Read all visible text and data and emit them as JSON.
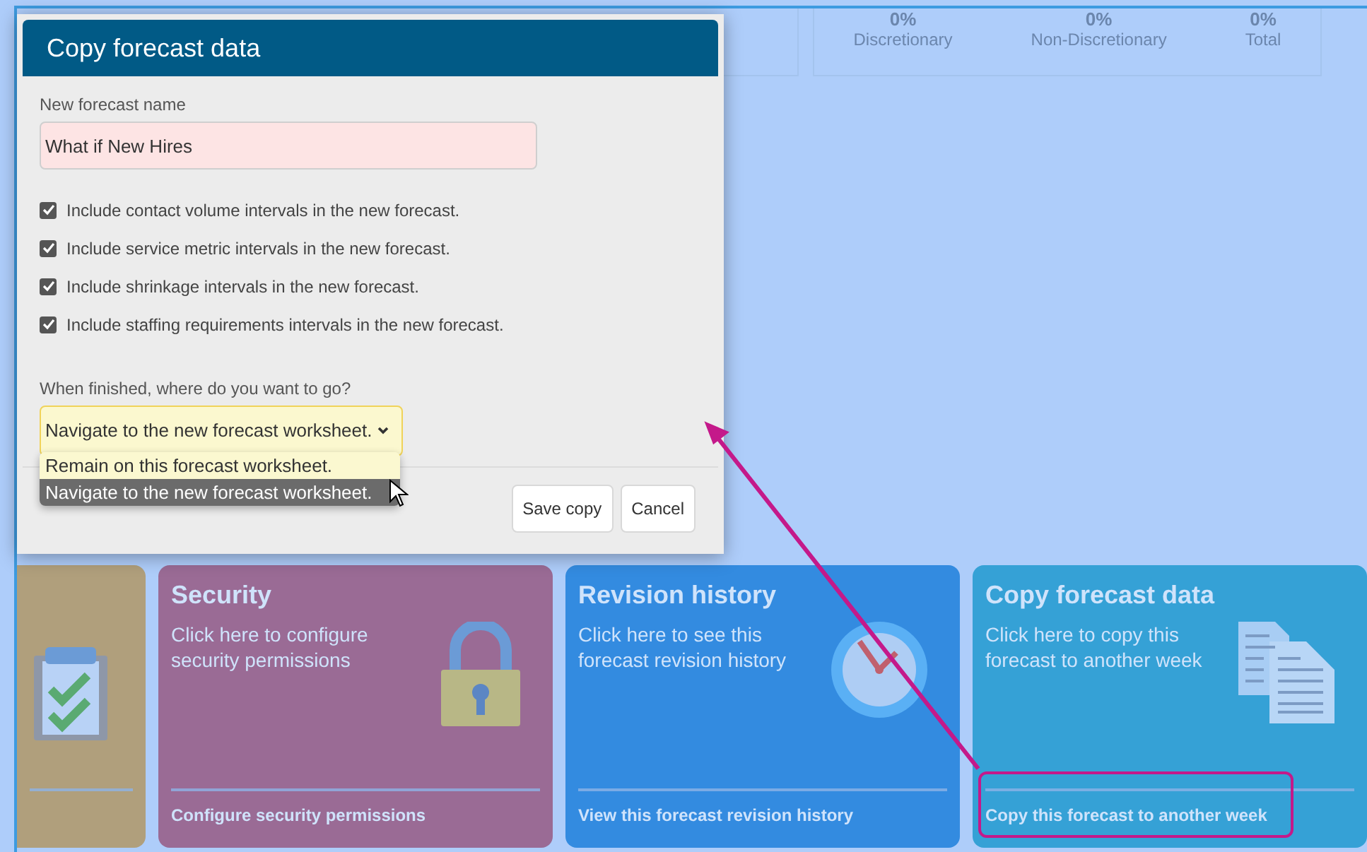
{
  "stats": [
    {
      "value": "0%",
      "label": "Discretionary"
    },
    {
      "value": "0%",
      "label": "Non-Discretionary"
    },
    {
      "value": "0%",
      "label": "Total"
    }
  ],
  "cards": [
    {
      "kind": "checklist",
      "color": "#b09f7c"
    },
    {
      "kind": "security",
      "color": "#9a6b95",
      "title": "Security",
      "description": "Click here to configure security permissions",
      "link": "Configure security permissions"
    },
    {
      "kind": "history",
      "color": "#338be0",
      "title": "Revision history",
      "description": "Click here to see this forecast revision history",
      "link": "View this forecast revision history"
    },
    {
      "kind": "copy",
      "color": "#35a1d6",
      "title": "Copy forecast data",
      "description": "Click here to copy this forecast to another week",
      "link": "Copy this forecast to another week"
    }
  ],
  "dialog": {
    "title": "Copy forecast data",
    "name_field": {
      "label": "New forecast name",
      "value": "What if New Hires"
    },
    "options": [
      {
        "label": "Include contact volume intervals in the new forecast.",
        "checked": true
      },
      {
        "label": "Include service metric intervals in the new forecast.",
        "checked": true
      },
      {
        "label": "Include shrinkage intervals in the new forecast.",
        "checked": true
      },
      {
        "label": "Include staffing requirements intervals in the new forecast.",
        "checked": true
      }
    ],
    "destination": {
      "label": "When finished, where do you want to go?",
      "value": "Navigate to the new forecast worksheet.",
      "menu": [
        {
          "label": "Remain on this forecast worksheet.",
          "selected": false
        },
        {
          "label": "Navigate to the new forecast worksheet.",
          "selected": true
        }
      ]
    },
    "buttons": [
      "Save copy",
      "Cancel"
    ]
  }
}
